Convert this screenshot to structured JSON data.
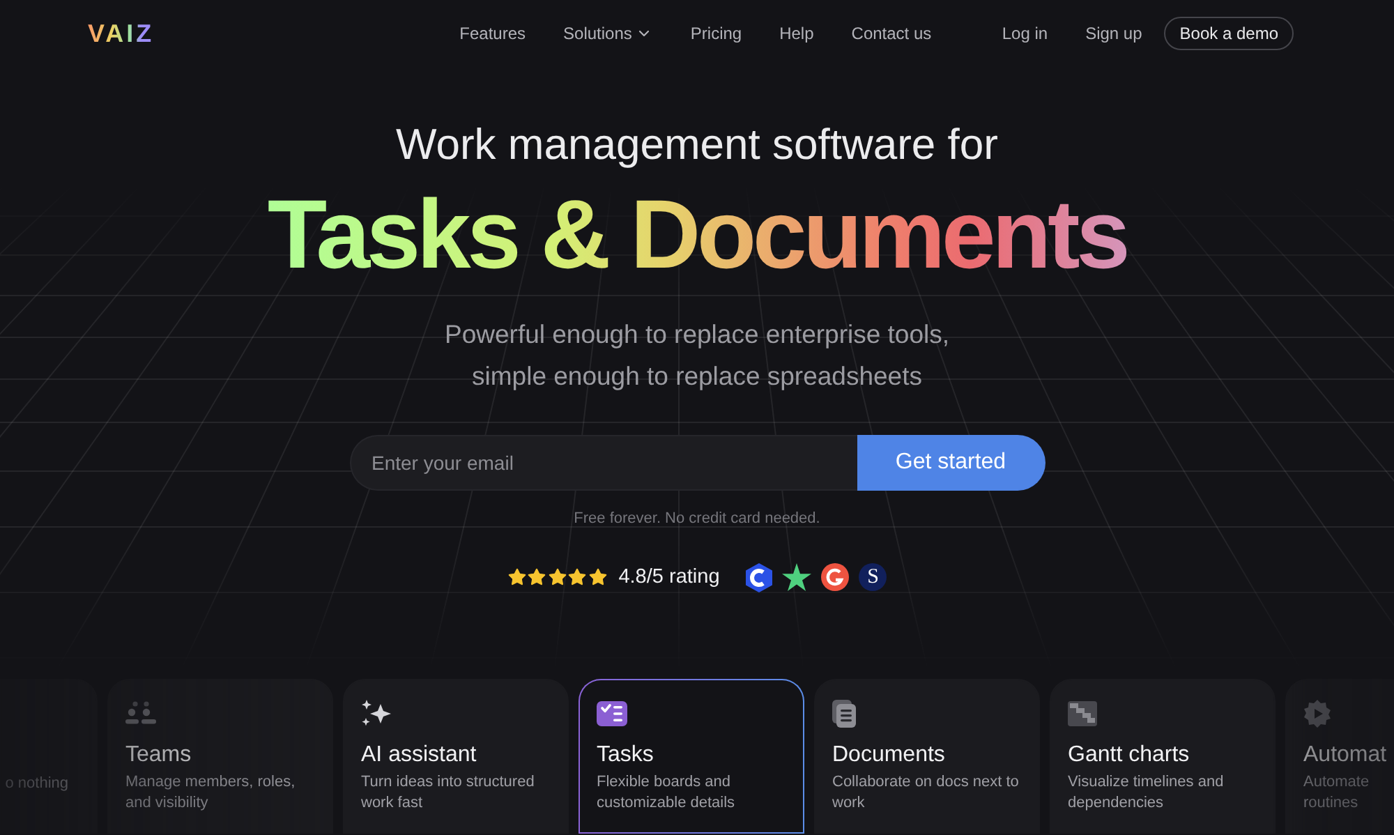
{
  "nav": {
    "logo": "VAIZ",
    "links": [
      {
        "label": "Features",
        "dropdown": false
      },
      {
        "label": "Solutions",
        "dropdown": true
      },
      {
        "label": "Pricing",
        "dropdown": false
      },
      {
        "label": "Help",
        "dropdown": false
      },
      {
        "label": "Contact us",
        "dropdown": false
      }
    ],
    "login": "Log in",
    "signup": "Sign up",
    "demo_button": "Book a demo"
  },
  "hero": {
    "kicker": "Work management software for",
    "headline": "Tasks & Documents",
    "subtitle": [
      "Powerful enough to replace enterprise tools,",
      "simple enough to replace spreadsheets"
    ]
  },
  "signup_form": {
    "placeholder": "Enter your email",
    "button": "Get started",
    "note": "Free forever. No credit card needed."
  },
  "rating": {
    "stars": 5,
    "text": "4.8/5 rating",
    "badges": [
      {
        "kind": "hexagon"
      },
      {
        "kind": "star"
      },
      {
        "kind": "circle"
      },
      {
        "kind": "letter",
        "label": "S"
      }
    ]
  },
  "features": [
    {
      "kind": "clipped_left",
      "description": [
        "o nothing"
      ],
      "selected": false
    },
    {
      "kind": "full",
      "title": "Teams",
      "description": [
        "Manage members, roles,",
        "and visibility"
      ],
      "selected": false
    },
    {
      "kind": "full",
      "title": "AI assistant",
      "description": [
        "Turn ideas into structured",
        "work fast"
      ],
      "selected": false
    },
    {
      "kind": "full",
      "title": "Tasks",
      "description": [
        "Flexible boards and",
        "customizable details"
      ],
      "selected": true
    },
    {
      "kind": "full",
      "title": "Documents",
      "description": [
        "Collaborate on docs next to",
        "work"
      ],
      "selected": false
    },
    {
      "kind": "full",
      "title": "Gantt charts",
      "description": [
        "Visualize timelines and",
        "dependencies"
      ],
      "selected": false
    },
    {
      "kind": "clipped_right",
      "title": "Automat",
      "description": [
        "Automate",
        "routines"
      ],
      "selected": false
    }
  ]
}
